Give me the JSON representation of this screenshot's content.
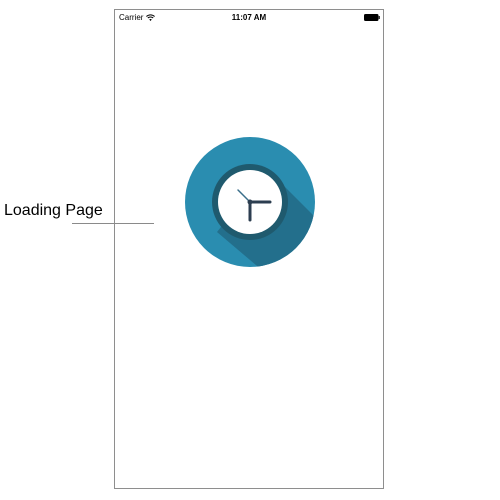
{
  "status_bar": {
    "carrier": "Carrier",
    "time": "11:07 AM",
    "wifi_icon": "wifi-icon",
    "battery_icon": "battery-icon"
  },
  "screen": {
    "logo_icon": "clock-icon",
    "colors": {
      "circle": "#2a8db0",
      "shadow": "#236f8c",
      "ring": "#1f5a6e",
      "face": "#ffffff",
      "hands": "#2c3e50"
    }
  },
  "annotation": {
    "label": "Loading Page"
  }
}
